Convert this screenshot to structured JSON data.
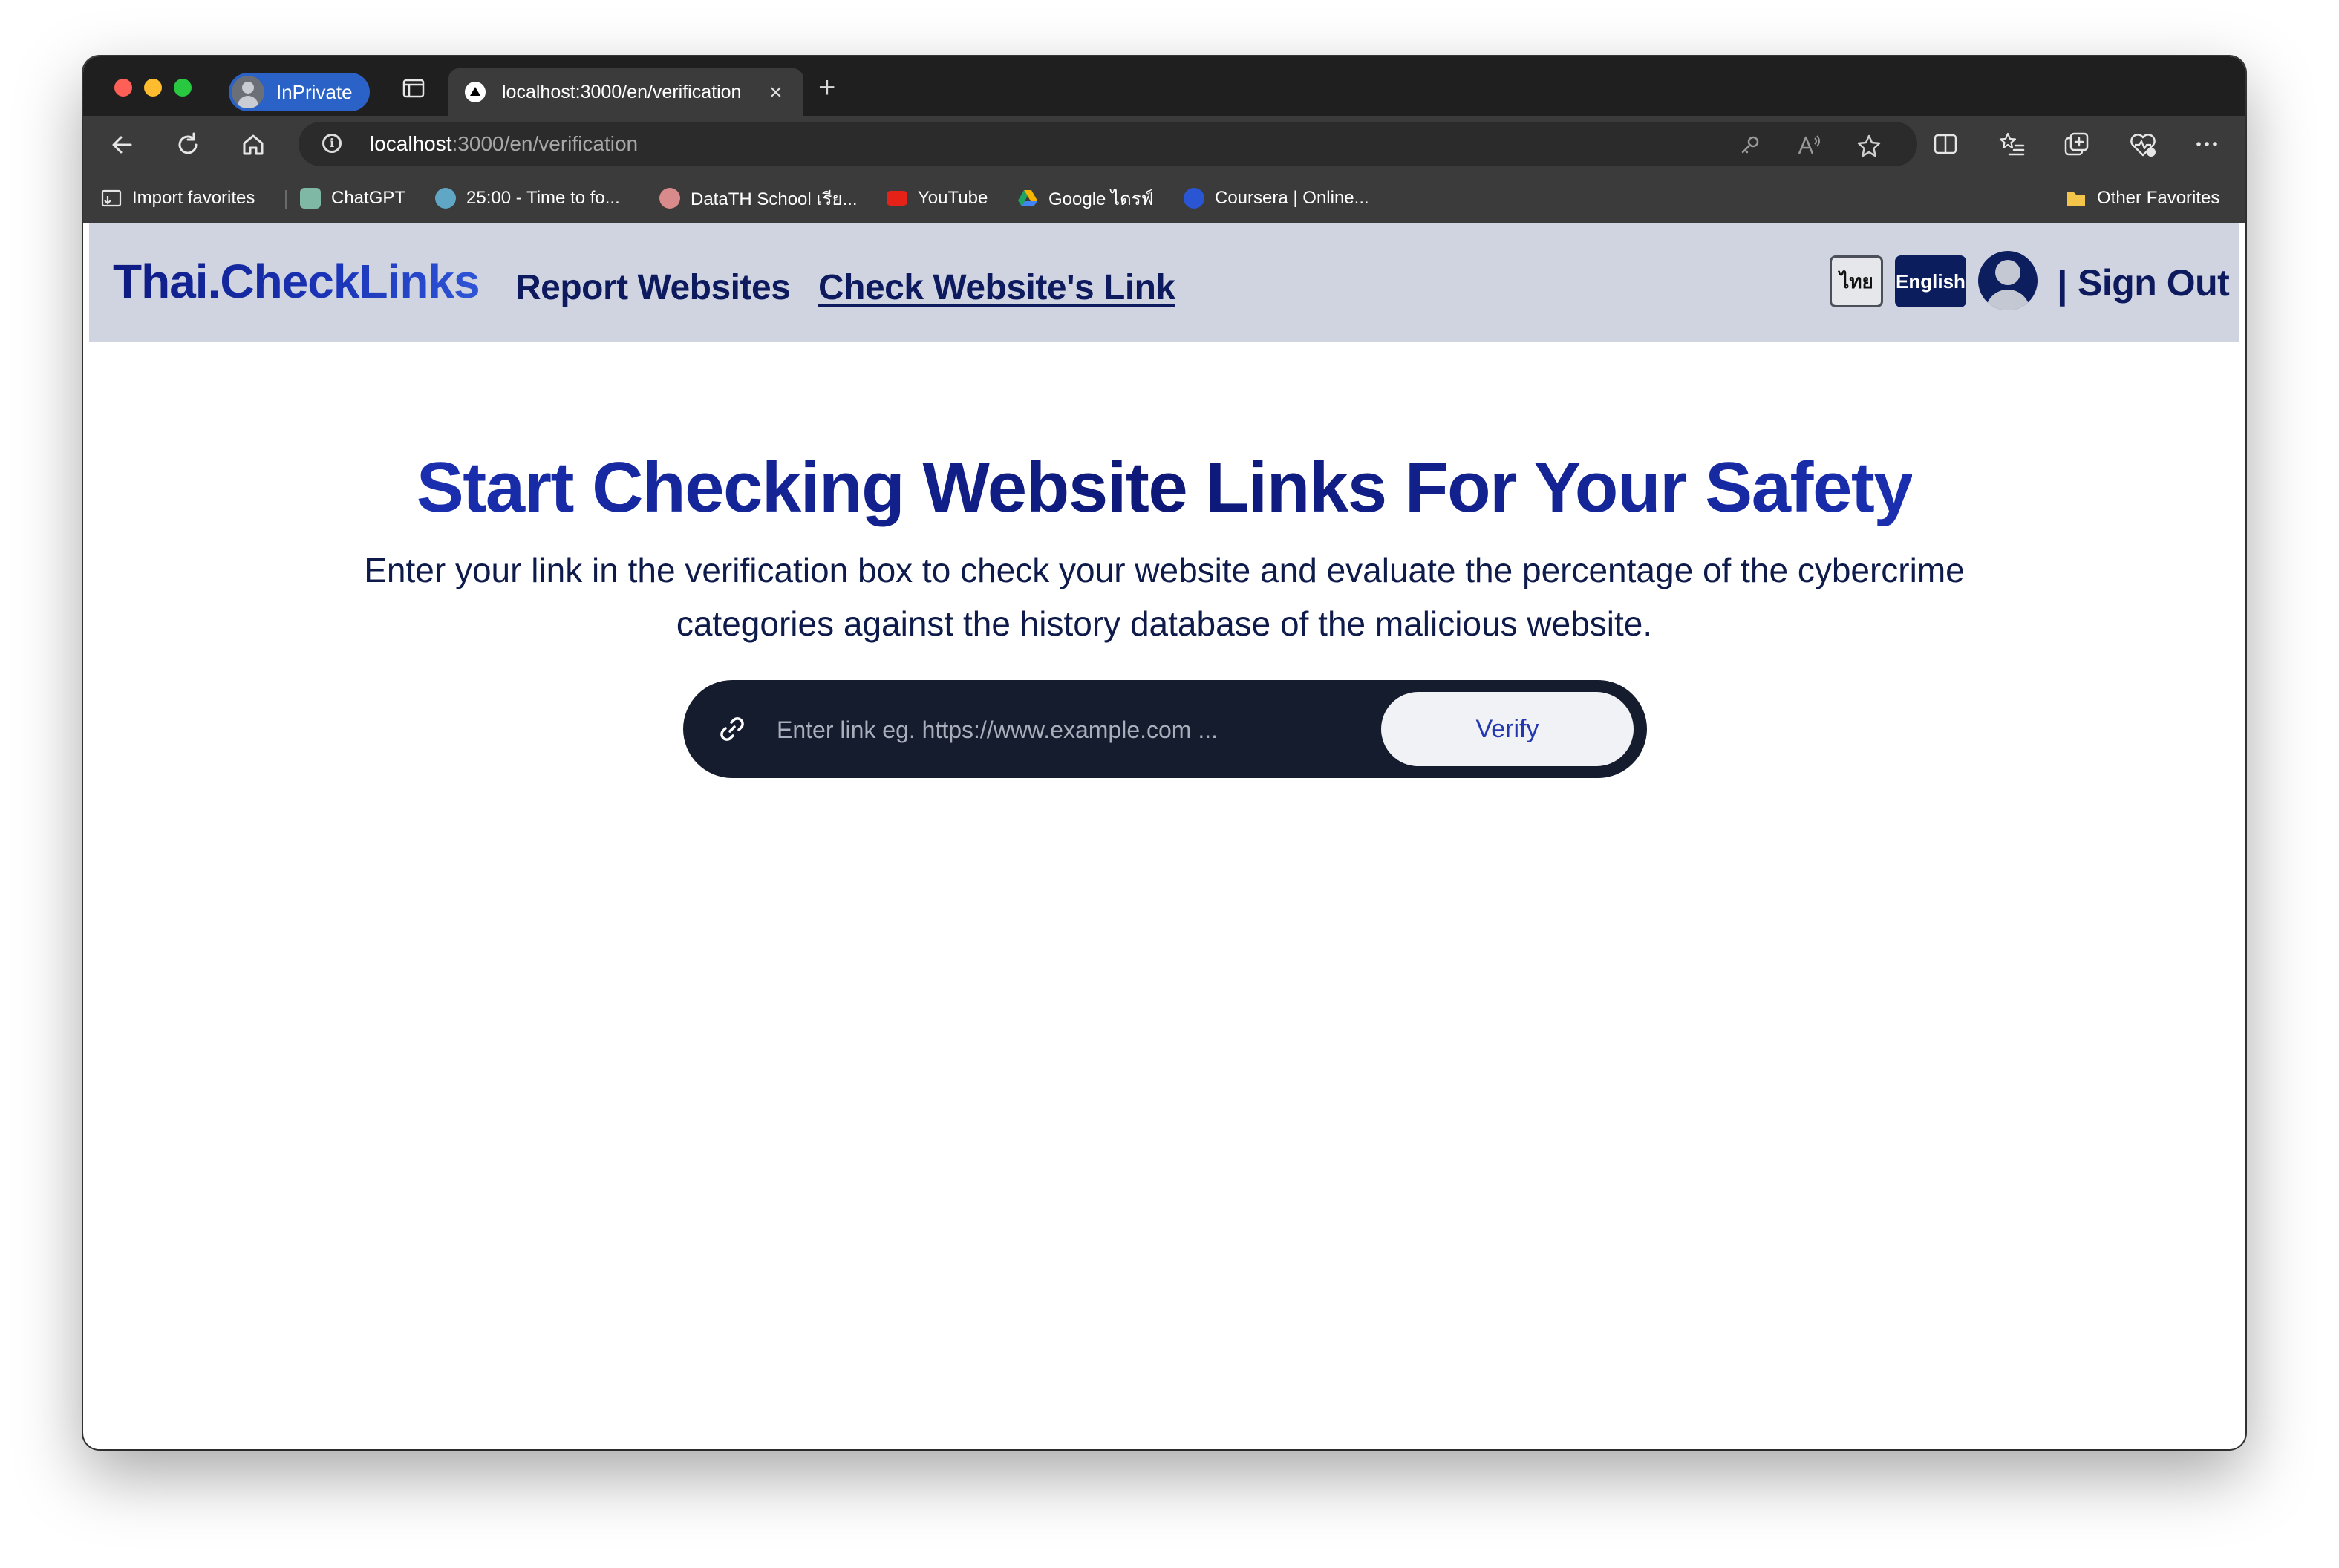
{
  "browser": {
    "profile_label": "InPrivate",
    "tab": {
      "title": "localhost:3000/en/verification",
      "close": "×"
    },
    "new_tab": "+",
    "address": {
      "host": "localhost",
      "path": ":3000/en/verification"
    },
    "bookmarks": [
      {
        "label": "Import favorites",
        "icon": "import-icon"
      },
      {
        "label": "ChatGPT",
        "icon": "chatgpt-icon"
      },
      {
        "label": "25:00 - Time to fo...",
        "icon": "check-circle-icon"
      },
      {
        "label": "DataTH School เรีย...",
        "icon": "datath-icon"
      },
      {
        "label": "YouTube",
        "icon": "youtube-icon"
      },
      {
        "label": "Google ไดรฟ์",
        "icon": "google-drive-icon"
      },
      {
        "label": "Coursera | Online...",
        "icon": "coursera-icon"
      }
    ],
    "other_favorites": "Other Favorites"
  },
  "site": {
    "brand": "Thai.CheckLinks",
    "nav": {
      "report": "Report Websites",
      "check": "Check Website's Link"
    },
    "lang": {
      "th": "ไทย",
      "en": "English"
    },
    "divider": "|",
    "sign_out": "Sign Out"
  },
  "hero": {
    "title": "Start Checking Website Links For Your Safety",
    "subtitle": "Enter your link in the verification box to check your website and evaluate the percentage of the cybercrime categories against the history database of the malicious website."
  },
  "verify": {
    "placeholder": "Enter link eg. https://www.example.com ...",
    "value": "",
    "button": "Verify"
  },
  "colors": {
    "header_bg": "#d0d4e0",
    "brand_dark": "#0d1a5e",
    "accent_blue": "#1a2fb0",
    "verify_box": "#151c2d"
  }
}
